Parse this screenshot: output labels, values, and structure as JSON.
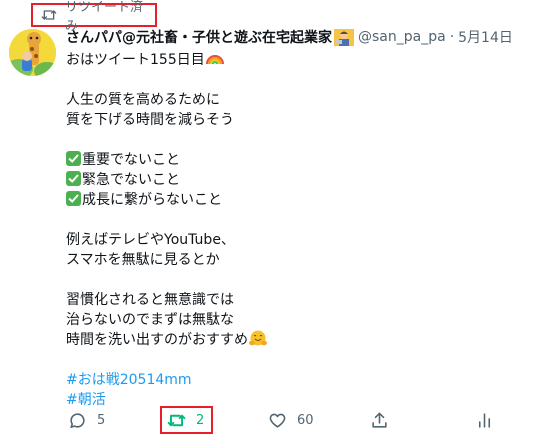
{
  "retweet_banner": {
    "label": "リツイート済み",
    "icon": "retweet-icon"
  },
  "tweet": {
    "author_name": "さんパパ@元社畜・子供と遊ぶ在宅起業家",
    "handle": "@san_pa_pa",
    "separator": "·",
    "date": "5月14日",
    "lines": [
      "おはツイート155日目",
      "",
      "人生の質を高めるために",
      "質を下げる時間を減らそう",
      "",
      "重要でないこと",
      "緊急でないこと",
      "成長に繋がらないこと",
      "",
      "例えばテレビやYouTube、",
      "スマホを無駄に見るとか",
      "",
      "習慣化されると無意識では",
      "治らないのでまずは無駄な",
      "時間を洗い出すのがおすすめ"
    ],
    "hashtags": [
      "#おは戦20514mm",
      "#朝活"
    ]
  },
  "actions": {
    "reply_count": "5",
    "retweet_count": "2",
    "like_count": "60"
  },
  "colors": {
    "accent": "#1d9bf0",
    "retweet_active": "#00ba7c",
    "muted": "#536471",
    "highlight_box": "#e5202a"
  }
}
